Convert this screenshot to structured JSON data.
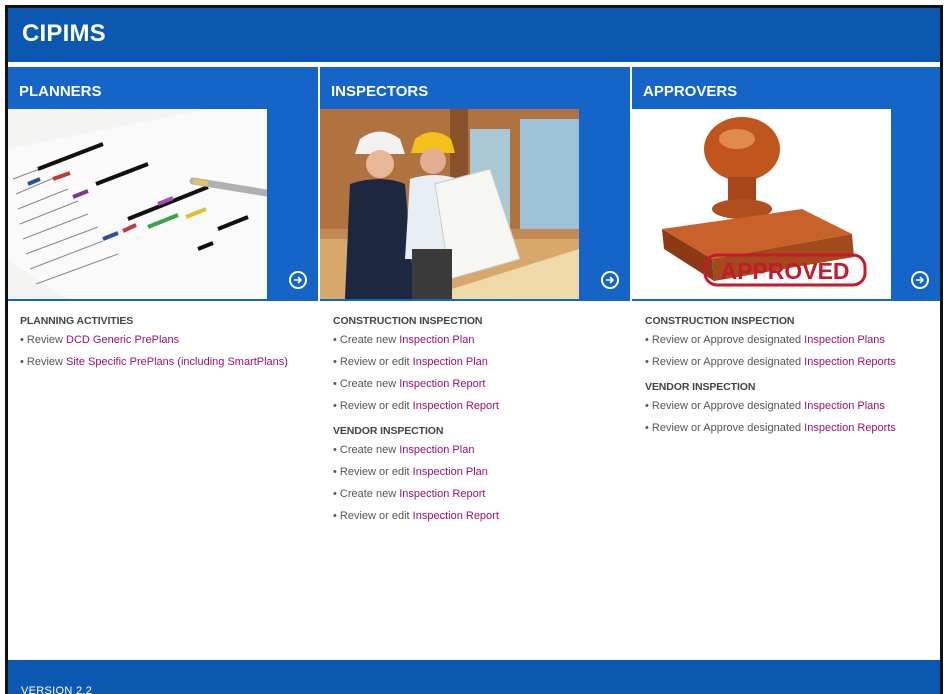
{
  "app": {
    "title": "CIPIMS"
  },
  "panels": {
    "planners": {
      "title": "PLANNERS"
    },
    "inspectors": {
      "title": "INSPECTORS"
    },
    "approvers": {
      "title": "APPROVERS",
      "stamp_text": "APPROVED"
    }
  },
  "planners_section": {
    "heading": "PLANNING ACTIVITIES",
    "items": [
      {
        "prefix": "• Review ",
        "link": "DCD Generic PrePlans"
      },
      {
        "prefix": "• Review ",
        "link": "Site Specific PrePlans (including SmartPlans)"
      }
    ]
  },
  "inspectors_section": {
    "construction_heading": "CONSTRUCTION INSPECTION",
    "construction_items": [
      {
        "prefix": "• Create new ",
        "link": "Inspection Plan"
      },
      {
        "prefix": "• Review or edit ",
        "link": "Inspection Plan"
      },
      {
        "prefix": "• Create new ",
        "link": "Inspection Report"
      },
      {
        "prefix": "• Review or edit ",
        "link": "Inspection Report"
      }
    ],
    "vendor_heading": "VENDOR INSPECTION",
    "vendor_items": [
      {
        "prefix": "• Create new ",
        "link": "Inspection Plan"
      },
      {
        "prefix": "• Review or edit ",
        "link": "Inspection Plan"
      },
      {
        "prefix": "• Create new ",
        "link": "Inspection Report"
      },
      {
        "prefix": "• Review or edit ",
        "link": "Inspection Report"
      }
    ]
  },
  "approvers_section": {
    "construction_heading": "CONSTRUCTION INSPECTION",
    "construction_items": [
      {
        "prefix": "• Review or Approve designated ",
        "link": "Inspection Plans"
      },
      {
        "prefix": "• Review or Approve designated ",
        "link": "Inspection Reports"
      }
    ],
    "vendor_heading": "VENDOR INSPECTION",
    "vendor_items": [
      {
        "prefix": "• Review or Approve designated ",
        "link": "Inspection Plans"
      },
      {
        "prefix": "• Review or Approve designated ",
        "link": "Inspection Reports"
      }
    ]
  },
  "footer": {
    "version": "VERSION 2.2"
  },
  "colors": {
    "header_blue": "#0a58b0",
    "panel_blue": "#1565c8",
    "link": "#9b0f7a"
  },
  "icons": {
    "panel_arrow": "circle-arrow-right-icon"
  }
}
